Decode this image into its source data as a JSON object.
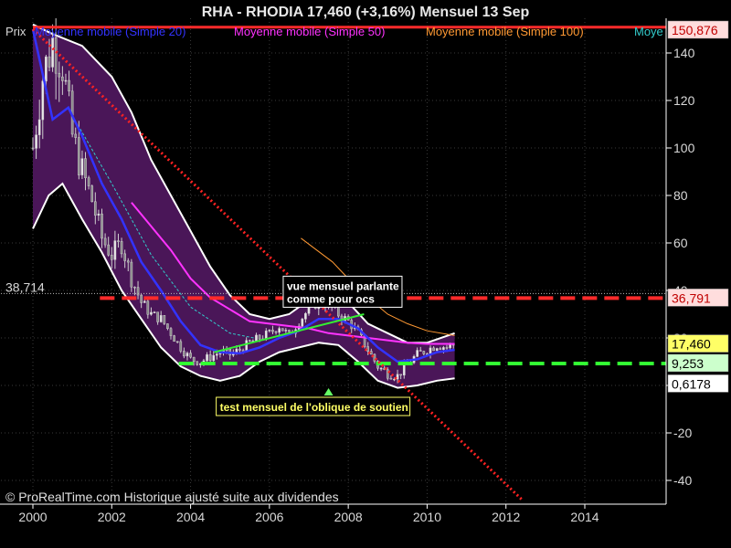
{
  "chart_data": {
    "type": "candlestick",
    "title": "RHA - RHODIA     17,460 (+3,16%)     Mensuel  13 Sep",
    "legend": [
      {
        "label": "Prix",
        "color": "#d8d8d8"
      },
      {
        "label": "Moyenne mobile (Simple 20)",
        "color": "#3333ff"
      },
      {
        "label": "Moyenne mobile (Simple 50)",
        "color": "#ff33ff"
      },
      {
        "label": "Moyenne mobile (Simple 100)",
        "color": "#ff9933"
      },
      {
        "label": "Moye",
        "color": "#33cccc"
      }
    ],
    "x_ticks": [
      "2000",
      "2002",
      "2004",
      "2006",
      "2008",
      "2010",
      "2012",
      "2014"
    ],
    "x_range": [
      1999.5,
      2015.9
    ],
    "y_ticks": [
      140,
      120,
      100,
      80,
      60,
      40,
      20,
      0,
      -20,
      -40
    ],
    "y_range": [
      -50,
      150
    ],
    "price_tags": [
      {
        "label": "150,876",
        "value": 150.876,
        "bg": "#ffdddd",
        "fg": "#c00000"
      },
      {
        "label": "36,791",
        "value": 36.791,
        "bg": "#ffdddd",
        "fg": "#c00000"
      },
      {
        "label": "17,460",
        "value": 17.46,
        "bg": "#ffff66",
        "fg": "#000000"
      },
      {
        "label": "9,253",
        "value": 9.253,
        "bg": "#ccffcc",
        "fg": "#000000"
      },
      {
        "label": "0,6178",
        "value": 0.6178,
        "bg": "#ffffff",
        "fg": "#000000"
      }
    ],
    "left_level": {
      "label": "38,714",
      "value": 38.714
    },
    "horizontal_levels": [
      {
        "value": 150.876,
        "x_start": 2000.0,
        "color": "#ff2a2a",
        "style": "solid"
      },
      {
        "value": 36.791,
        "x_start": 2001.7,
        "color": "#ff2a2a",
        "style": "dashed"
      },
      {
        "value": 9.253,
        "x_start": 2003.7,
        "color": "#33ff33",
        "style": "dashed"
      }
    ],
    "trend_lines": [
      {
        "name": "oblique baissière",
        "points": [
          [
            2000.0,
            150
          ],
          [
            2012.4,
            -48
          ]
        ],
        "color": "#ff2222",
        "style": "dotted"
      },
      {
        "name": "oblique de soutien",
        "points": [
          [
            2004.6,
            14
          ],
          [
            2008.4,
            30
          ]
        ],
        "color": "#33ee33",
        "style": "solid"
      }
    ],
    "annotations": [
      {
        "text": [
          "vue mensuel parlante",
          "comme pour ocs"
        ],
        "x": 2006.35,
        "y": 46,
        "style": "box-white"
      },
      {
        "text": [
          "test mensuel de l'oblique de soutien"
        ],
        "x": 2004.65,
        "y": -5,
        "style": "box-yellow"
      }
    ],
    "copyright": "© ProRealTime.com Historique ajusté suite aux dividendes",
    "price": [
      [
        2000.0,
        100
      ],
      [
        2000.25,
        130
      ],
      [
        2000.5,
        145
      ],
      [
        2000.75,
        135
      ],
      [
        2001.0,
        105
      ],
      [
        2001.25,
        90
      ],
      [
        2001.5,
        78
      ],
      [
        2001.75,
        62
      ],
      [
        2002.0,
        55
      ],
      [
        2002.25,
        60
      ],
      [
        2002.5,
        45
      ],
      [
        2002.75,
        35
      ],
      [
        2003.0,
        30
      ],
      [
        2003.25,
        28
      ],
      [
        2003.5,
        22
      ],
      [
        2003.75,
        16
      ],
      [
        2004.0,
        11
      ],
      [
        2004.25,
        10
      ],
      [
        2004.5,
        12
      ],
      [
        2004.75,
        14
      ],
      [
        2005.0,
        13
      ],
      [
        2005.25,
        15
      ],
      [
        2005.5,
        18
      ],
      [
        2005.75,
        20
      ],
      [
        2006.0,
        22
      ],
      [
        2006.25,
        25
      ],
      [
        2006.5,
        21
      ],
      [
        2006.75,
        27
      ],
      [
        2007.0,
        32
      ],
      [
        2007.25,
        36
      ],
      [
        2007.5,
        34
      ],
      [
        2007.75,
        30
      ],
      [
        2008.0,
        27
      ],
      [
        2008.25,
        22
      ],
      [
        2008.5,
        15
      ],
      [
        2008.75,
        8
      ],
      [
        2009.0,
        5
      ],
      [
        2009.25,
        4
      ],
      [
        2009.5,
        9
      ],
      [
        2009.75,
        13
      ],
      [
        2010.0,
        15
      ],
      [
        2010.25,
        17
      ],
      [
        2010.5,
        16
      ],
      [
        2010.7,
        17.46
      ]
    ],
    "ma20": [
      [
        2000.0,
        150
      ],
      [
        2000.5,
        112
      ],
      [
        2000.9,
        117
      ],
      [
        2001.25,
        105
      ],
      [
        2001.75,
        85
      ],
      [
        2002.25,
        70
      ],
      [
        2002.75,
        52
      ],
      [
        2003.25,
        40
      ],
      [
        2003.75,
        27
      ],
      [
        2004.25,
        17
      ],
      [
        2004.75,
        14
      ],
      [
        2005.25,
        13.5
      ],
      [
        2005.75,
        16
      ],
      [
        2006.25,
        20
      ],
      [
        2006.75,
        23
      ],
      [
        2007.25,
        28
      ],
      [
        2007.75,
        28
      ],
      [
        2008.25,
        24
      ],
      [
        2008.75,
        16
      ],
      [
        2009.25,
        10
      ],
      [
        2009.75,
        11
      ],
      [
        2010.25,
        14
      ],
      [
        2010.7,
        15
      ]
    ],
    "ma50": [
      [
        2002.5,
        77
      ],
      [
        2003.0,
        67
      ],
      [
        2003.5,
        57
      ],
      [
        2004.0,
        45
      ],
      [
        2004.5,
        37
      ],
      [
        2005.0,
        32
      ],
      [
        2005.5,
        27
      ],
      [
        2006.0,
        26
      ],
      [
        2006.5,
        25
      ],
      [
        2007.0,
        24
      ],
      [
        2007.5,
        22
      ],
      [
        2008.0,
        21
      ],
      [
        2008.5,
        20
      ],
      [
        2009.0,
        19
      ],
      [
        2009.5,
        18
      ],
      [
        2010.0,
        17.5
      ],
      [
        2010.7,
        17.5
      ]
    ],
    "ma100": [
      [
        2006.8,
        62
      ],
      [
        2007.2,
        57
      ],
      [
        2007.6,
        52
      ],
      [
        2008.0,
        45
      ],
      [
        2008.5,
        37
      ],
      [
        2009.0,
        30
      ],
      [
        2009.5,
        26
      ],
      [
        2010.0,
        23
      ],
      [
        2010.7,
        21
      ]
    ],
    "ma_cyan": [
      [
        2001.2,
        108
      ],
      [
        2002.0,
        85
      ],
      [
        2003.0,
        55
      ],
      [
        2004.0,
        33
      ],
      [
        2005.0,
        22
      ],
      [
        2005.6,
        20
      ]
    ],
    "bollinger_upper": [
      [
        2000.0,
        152
      ],
      [
        2000.5,
        148
      ],
      [
        2001.25,
        143
      ],
      [
        2002.0,
        130
      ],
      [
        2002.5,
        115
      ],
      [
        2003.0,
        95
      ],
      [
        2003.5,
        80
      ],
      [
        2004.0,
        65
      ],
      [
        2004.5,
        50
      ],
      [
        2005.0,
        38
      ],
      [
        2005.5,
        30
      ],
      [
        2006.0,
        28
      ],
      [
        2006.5,
        30
      ],
      [
        2007.0,
        36
      ],
      [
        2007.5,
        39
      ],
      [
        2008.0,
        35
      ],
      [
        2008.5,
        26
      ],
      [
        2009.0,
        22
      ],
      [
        2009.5,
        18
      ],
      [
        2010.0,
        18
      ],
      [
        2010.7,
        22
      ]
    ],
    "bollinger_lower": [
      [
        2000.0,
        66
      ],
      [
        2000.4,
        80
      ],
      [
        2000.75,
        85
      ],
      [
        2001.25,
        70
      ],
      [
        2001.75,
        56
      ],
      [
        2002.25,
        40
      ],
      [
        2002.75,
        28
      ],
      [
        2003.25,
        16
      ],
      [
        2003.75,
        8
      ],
      [
        2004.25,
        4
      ],
      [
        2004.75,
        2
      ],
      [
        2005.25,
        4
      ],
      [
        2005.75,
        10
      ],
      [
        2006.25,
        14
      ],
      [
        2006.75,
        16
      ],
      [
        2007.25,
        18
      ],
      [
        2007.75,
        17
      ],
      [
        2008.25,
        10
      ],
      [
        2008.75,
        2
      ],
      [
        2009.25,
        -1
      ],
      [
        2009.75,
        0
      ],
      [
        2010.25,
        2
      ],
      [
        2010.7,
        3
      ]
    ]
  }
}
